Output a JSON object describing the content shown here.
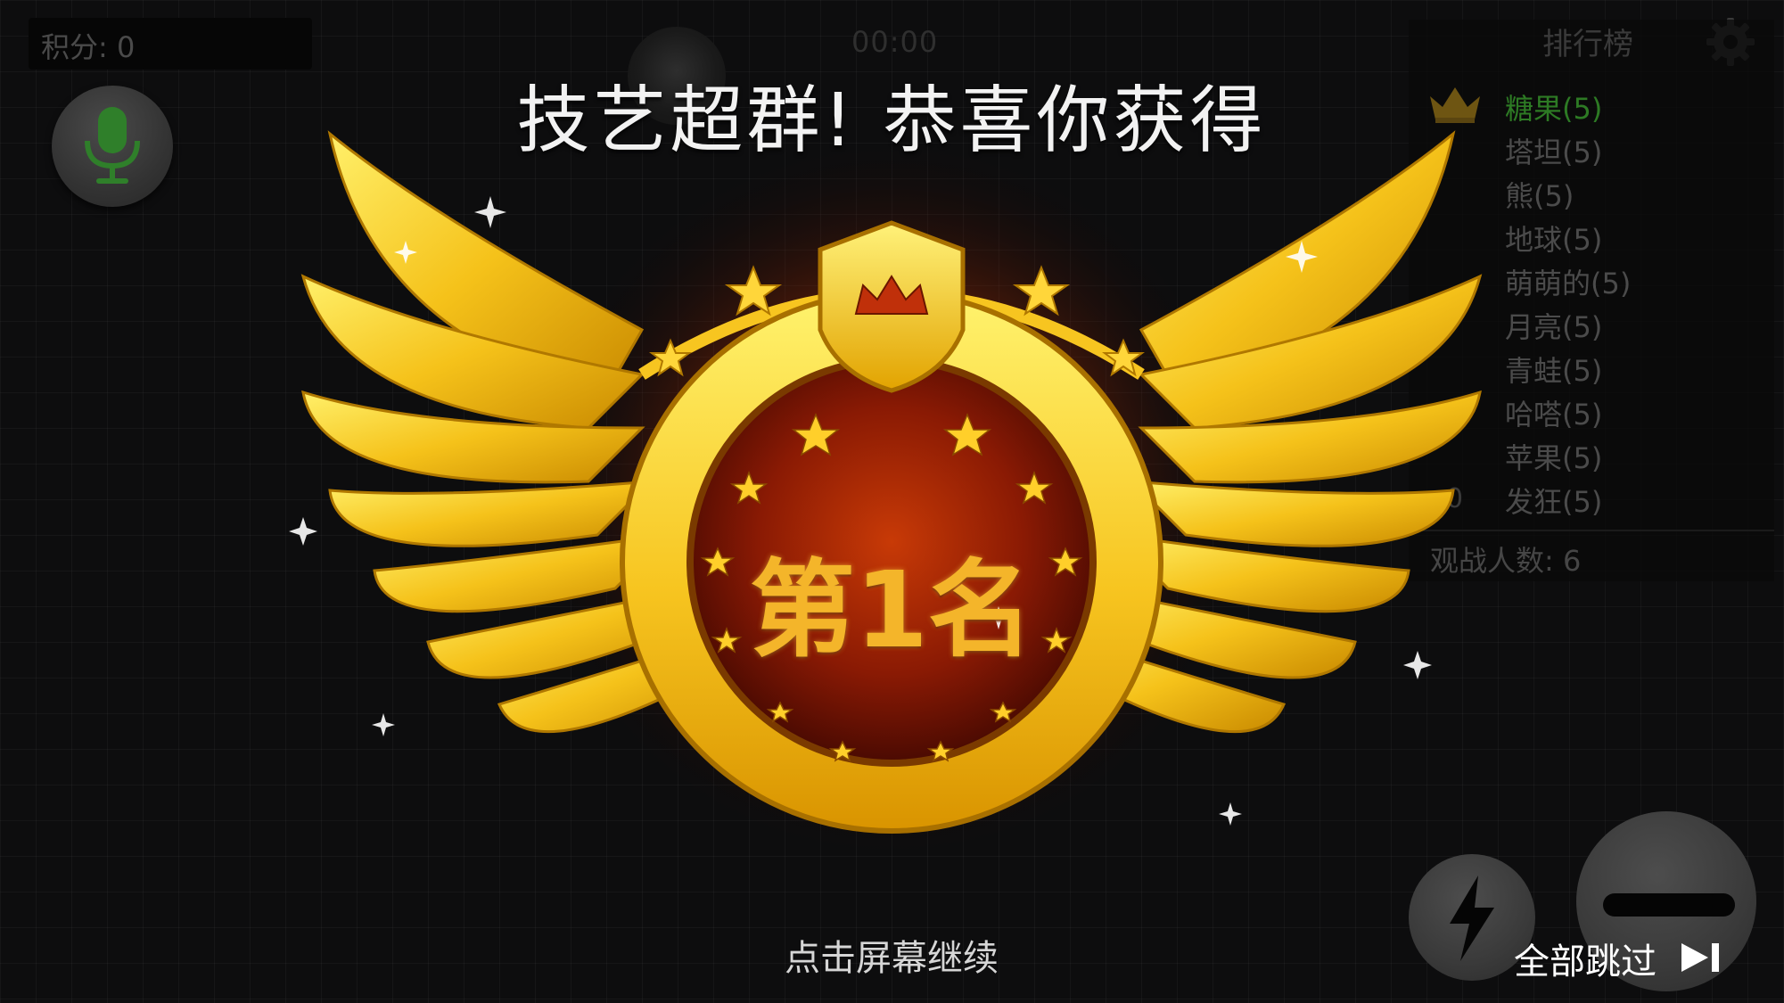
{
  "score": {
    "text": "积分: 0"
  },
  "timer": {
    "text": "00:00"
  },
  "leaderboard": {
    "title": "排行榜",
    "entries": [
      "糖果(5)",
      "塔坦(5)",
      "熊(5)",
      "地球(5)",
      "萌萌的(5)",
      "月亮(5)",
      "青蛙(5)",
      "哈嗒(5)",
      "苹果(5)",
      "发狂(5)"
    ],
    "last_rank": "0",
    "watchers": "观战人数: 6"
  },
  "award": {
    "headline": "技艺超群!  恭喜你获得",
    "rank_label": "第1名"
  },
  "footer": {
    "tap_continue": "点击屏幕继续",
    "skip_all": "全部跳过"
  },
  "colors": {
    "gold": "#f7c520",
    "deep_red": "#5a0d02",
    "leader_first": "#2d7a24"
  },
  "icons": [
    "microphone-icon",
    "gear-icon",
    "crown-icon",
    "lightning-icon",
    "minus-icon",
    "skip-forward-icon"
  ]
}
